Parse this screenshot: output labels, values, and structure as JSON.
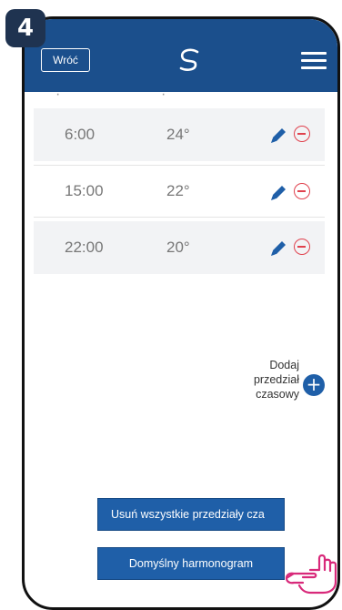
{
  "step_number": "4",
  "header": {
    "back_label": "Wróć",
    "logo_icon": "brand-s-logo-icon",
    "menu_icon": "hamburger-menu-icon"
  },
  "schedule": {
    "rows": [
      {
        "time": "6:00",
        "temp": "24°"
      },
      {
        "time": "15:00",
        "temp": "22°"
      },
      {
        "time": "22:00",
        "temp": "20°"
      }
    ]
  },
  "add_interval": {
    "line1": "Dodaj",
    "line2": "przedział",
    "line3": "czasowy",
    "icon": "plus"
  },
  "buttons": {
    "delete_all": "Usuń wszystkie przedziały cza",
    "default_schedule": "Domyślny harmonogram"
  },
  "colors": {
    "header_bg": "#1b4f8c",
    "accent": "#1f5fa8",
    "delete": "#e0424e"
  }
}
